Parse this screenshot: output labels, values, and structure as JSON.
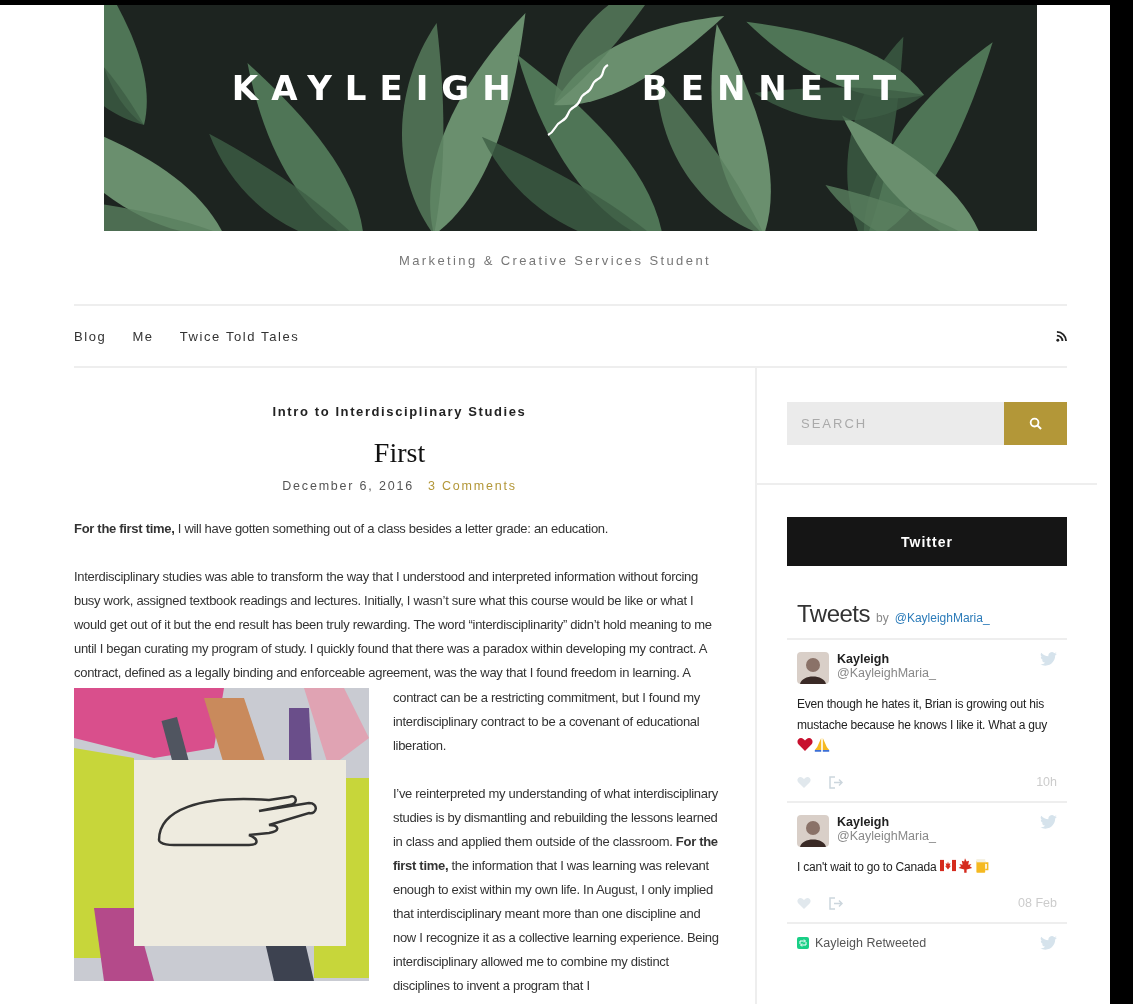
{
  "header": {
    "title_first": "KAYLEIGH",
    "title_last": "BENNETT",
    "tagline": "Marketing & Creative Services Student"
  },
  "nav": {
    "items": [
      {
        "label": "Blog"
      },
      {
        "label": "Me"
      },
      {
        "label": "Twice Told Tales"
      }
    ]
  },
  "post": {
    "category": "Intro to Interdisciplinary Studies",
    "title": "First",
    "date": "December 6, 2016",
    "comments": "3 Comments",
    "paragraphs": [
      "**For the first time,** I will have gotten something out of a class besides a letter grade: an education.",
      "Interdisciplinary studies was able to transform the way that I understood and interpreted information without forcing busy work, assigned textbook readings and lectures. Initially, I wasn’t sure what this course would be like or what I would get out of it but the end result has been truly rewarding. The word “interdisciplinarity” didn’t hold meaning to me until I began curating my program of study. I quickly found that there was a paradox within developing my contract. A contract, defined as a legally binding and enforceable agreement, was the way that I found freedom in learning. A",
      "contract can be a restricting commitment, but I found my interdisciplinary contract to be a covenant of educational liberation.",
      "I’ve reinterpreted my understanding of what interdisciplinary studies is by dismantling and rebuilding the lessons learned in class and applied them outside of the classroom. **For the first time,** the information that I was learning was relevant enough to exist within my own life. In August, I only implied that interdisciplinary meant more than one discipline and now I recognize it as a collective learning experience. Being interdisciplinary allowed me to combine my distinct disciplines to invent a program that I"
    ]
  },
  "sidebar": {
    "search": {
      "placeholder": "SEARCH"
    },
    "widget_title": "Twitter",
    "timeline": {
      "heading": "Tweets",
      "by": "by",
      "handle": "@KayleighMaria_",
      "tweets": [
        {
          "name": "Kayleigh",
          "handle": "@KayleighMaria_",
          "text": "Even though he hates it, Brian is growing out his mustache because he knows I like it. What a guy",
          "emojis": [
            {
              "kind": "heart"
            },
            {
              "kind": "praying-hands"
            }
          ],
          "time": "10h"
        },
        {
          "name": "Kayleigh",
          "handle": "@KayleighMaria_",
          "text": "I can't wait to go to Canada",
          "emojis": [
            {
              "kind": "canada-flag"
            },
            {
              "kind": "maple-leaf"
            },
            {
              "kind": "beer"
            }
          ],
          "time": "08 Feb"
        }
      ],
      "retweet_notice": "Kayleigh Retweeted"
    }
  }
}
